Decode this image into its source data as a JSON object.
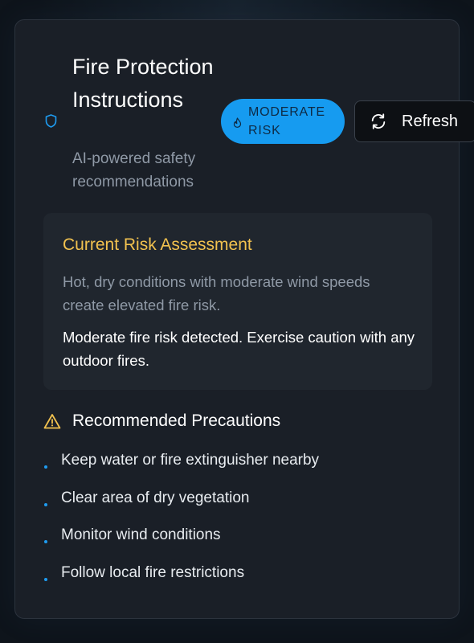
{
  "header": {
    "title": "Fire Protection Instructions",
    "subtitle": "AI-powered safety recommendations",
    "risk_badge": "MODERATE RISK",
    "refresh_label": "Refresh"
  },
  "assessment": {
    "heading": "Current Risk Assessment",
    "description": "Hot, dry conditions with moderate wind speeds create elevated fire risk.",
    "message": "Moderate fire risk detected. Exercise caution with any outdoor fires."
  },
  "precautions": {
    "heading": "Recommended Precautions",
    "items": [
      "Keep water or fire extinguisher nearby",
      "Clear area of dry vegetation",
      "Monitor wind conditions",
      "Follow local fire restrictions"
    ]
  },
  "icons": {
    "header_icon": "shield-icon",
    "badge_icon": "flame-icon",
    "refresh_icon": "refresh-icon",
    "precautions_icon": "warning-triangle-icon"
  },
  "colors": {
    "accent_blue": "#169bf0",
    "assessment_heading": "#f2c24f",
    "card_background": "#1a1f27"
  }
}
